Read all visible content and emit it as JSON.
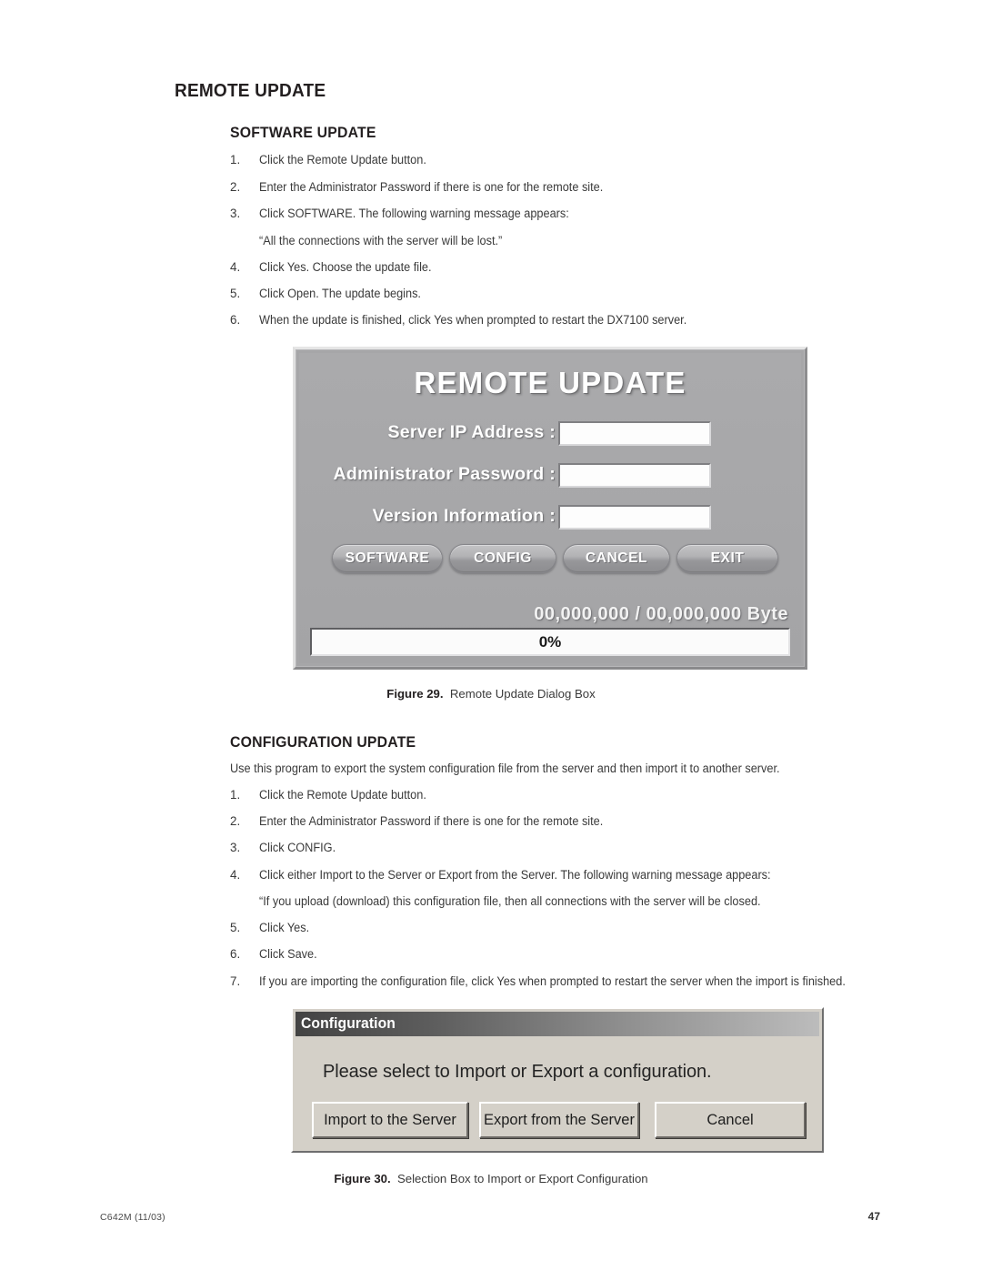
{
  "document": {
    "heading": "REMOTE UPDATE",
    "footer_left": "C642M (11/03)",
    "footer_page": "47"
  },
  "software_update": {
    "heading": "SOFTWARE UPDATE",
    "steps": [
      {
        "num": "1.",
        "text": "Click the Remote Update button."
      },
      {
        "num": "2.",
        "text": "Enter the Administrator Password if there is one for the remote site."
      },
      {
        "num": "3.",
        "text": "Click SOFTWARE. The following warning message appears:"
      },
      {
        "num": "4.",
        "text": "Click Yes. Choose the update file."
      },
      {
        "num": "5.",
        "text": "Click Open. The update begins."
      },
      {
        "num": "6.",
        "text": "When the update is finished, click Yes when prompted to restart the DX7100 server."
      }
    ],
    "quote": "“All the connections with the server will be lost.”"
  },
  "figure_29": {
    "caption_label": "Figure 29.",
    "caption_text": "Remote Update Dialog Box",
    "dialog": {
      "title": "REMOTE UPDATE",
      "fields": [
        {
          "label": "Server IP Address :",
          "value": ""
        },
        {
          "label": "Administrator Password :",
          "value": ""
        },
        {
          "label": "Version Information :",
          "value": ""
        }
      ],
      "buttons": [
        {
          "label": "SOFTWARE"
        },
        {
          "label": "CONFIG"
        },
        {
          "label": "CANCEL"
        },
        {
          "label": "EXIT"
        }
      ],
      "byte_counter": "00,000,000 / 00,000,000 Byte",
      "progress_label": "0%",
      "progress_percent": 0,
      "colors": {
        "dialog_background": "#a8a8aa",
        "text": "#ffffff",
        "field_background": "#fdfdfd"
      }
    }
  },
  "configuration_update": {
    "heading": "CONFIGURATION UPDATE",
    "intro": "Use this program to export the system configuration file from the server and then import it to another server.",
    "steps": [
      {
        "num": "1.",
        "text": "Click the Remote Update button."
      },
      {
        "num": "2.",
        "text": "Enter the Administrator Password if there is one for the remote site."
      },
      {
        "num": "3.",
        "text": "Click CONFIG."
      },
      {
        "num": "4.",
        "text": "Click either Import to the Server or Export from the Server. The following warning message appears:"
      },
      {
        "num": "5.",
        "text": "Click Yes."
      },
      {
        "num": "6.",
        "text": "Click Save."
      },
      {
        "num": "7.",
        "text": "If you are importing the configuration file, click Yes when prompted to restart the server when the import is finished."
      }
    ],
    "quote": "“If you upload (download) this configuration file, then all connections with the server will be closed."
  },
  "figure_30": {
    "caption_label": "Figure 30.",
    "caption_text": "Selection Box to Import or Export Configuration",
    "dialog": {
      "title": "Configuration",
      "message": "Please select to Import or Export a configuration.",
      "buttons": [
        {
          "label": "Import to the Server"
        },
        {
          "label": "Export from the Server"
        },
        {
          "label": "Cancel"
        }
      ],
      "colors": {
        "titlebar_start": "#434343",
        "titlebar_end": "#bcbcbc",
        "face": "#d4d0c8"
      }
    }
  }
}
